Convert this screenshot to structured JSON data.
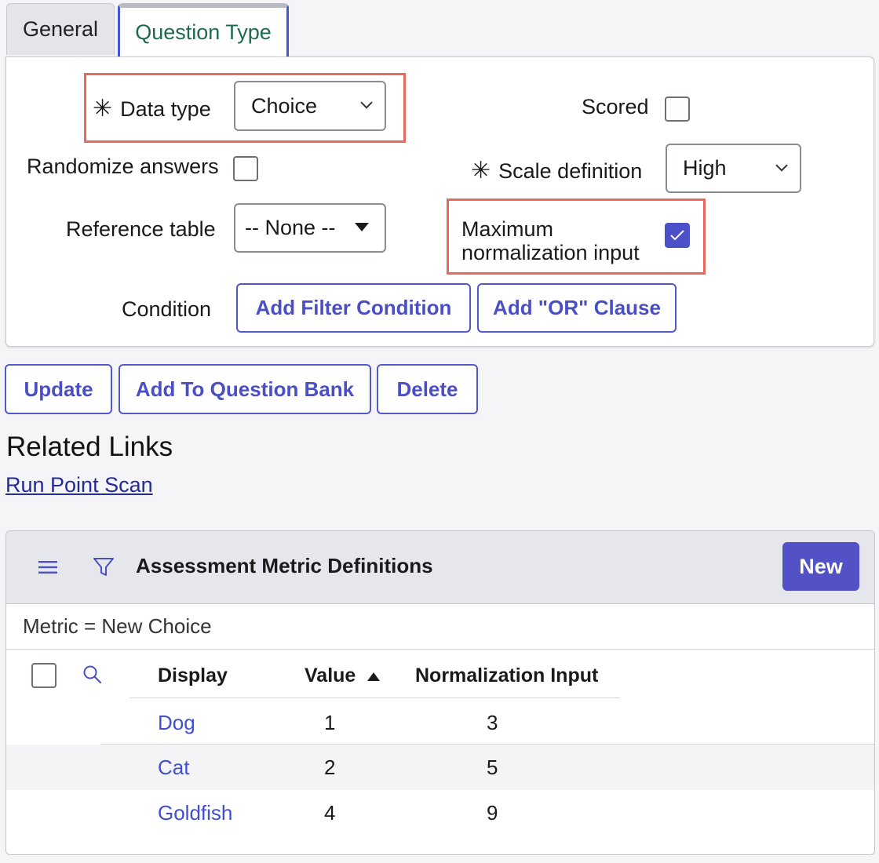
{
  "tabs": [
    {
      "label": "General",
      "active": false
    },
    {
      "label": "Question Type",
      "active": true
    }
  ],
  "form": {
    "data_type": {
      "label": "Data type",
      "required_mark": "✳",
      "value": "Choice"
    },
    "scored": {
      "label": "Scored",
      "checked": false
    },
    "randomize_answers": {
      "label": "Randomize answers",
      "checked": false
    },
    "scale_definition": {
      "label": "Scale definition",
      "required_mark": "✳",
      "value": "High"
    },
    "reference_table": {
      "label": "Reference table",
      "value": "-- None --"
    },
    "max_normalization": {
      "label_line1": "Maximum",
      "label_line2": "normalization input",
      "checked": true
    },
    "condition": {
      "label": "Condition",
      "add_filter": "Add Filter Condition",
      "add_or": "Add \"OR\" Clause"
    }
  },
  "actions": {
    "update": "Update",
    "add_to_bank": "Add To Question Bank",
    "delete": "Delete"
  },
  "related_links": {
    "title": "Related Links",
    "links": [
      "Run Point Scan"
    ]
  },
  "list": {
    "title": "Assessment Metric Definitions",
    "new_label": "New",
    "filter_text": "Metric = New Choice",
    "columns": {
      "display": "Display",
      "value": "Value",
      "normalization": "Normalization Input"
    },
    "sort_column": "Value",
    "rows": [
      {
        "display": "Dog",
        "value": "1",
        "normalization": "3"
      },
      {
        "display": "Cat",
        "value": "2",
        "normalization": "5"
      },
      {
        "display": "Goldfish",
        "value": "4",
        "normalization": "9"
      }
    ]
  },
  "colors": {
    "accent": "#4b50c9",
    "highlight": "#e66a5c",
    "active_tab_text": "#1d6b4d"
  }
}
